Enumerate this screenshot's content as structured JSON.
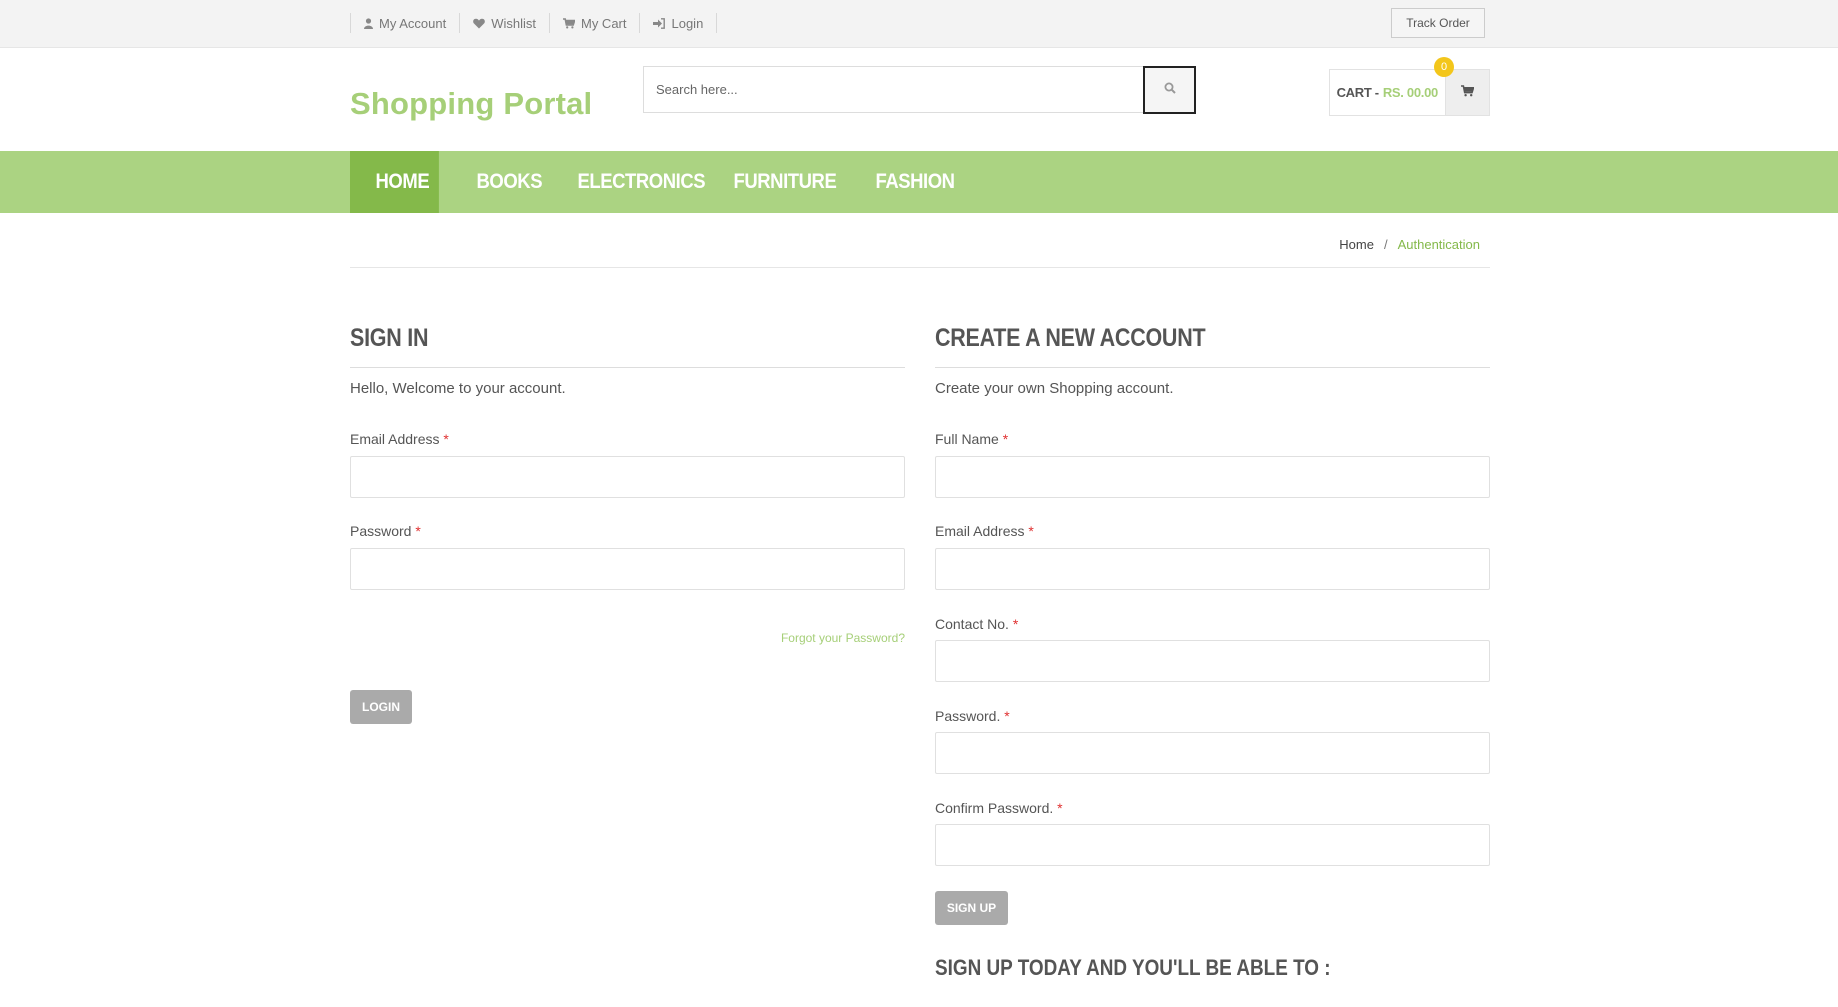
{
  "topbar": {
    "links": [
      {
        "label": "My Account",
        "icon": "user-icon"
      },
      {
        "label": "Wishlist",
        "icon": "heart-icon"
      },
      {
        "label": "My Cart",
        "icon": "cart-icon"
      },
      {
        "label": "Login",
        "icon": "sign-in-icon"
      }
    ],
    "track_order": "Track Order"
  },
  "header": {
    "logo": "Shopping Portal",
    "search_placeholder": "Search here...",
    "cart_label": "CART -",
    "cart_amount": "RS. 00.00",
    "cart_count": "0"
  },
  "nav": {
    "items": [
      "HOME",
      "BOOKS",
      "ELECTRONICS",
      "FURNITURE",
      "FASHION"
    ],
    "active": "HOME"
  },
  "breadcrumb": {
    "home": "Home",
    "separator": "/",
    "current": "Authentication"
  },
  "signin": {
    "title": "SIGN IN",
    "subtitle": "Hello, Welcome to your account.",
    "email_label": "Email Address",
    "password_label": "Password",
    "required_mark": "*",
    "forgot": "Forgot your Password?",
    "login_button": "LOGIN"
  },
  "signup": {
    "title": "CREATE A NEW ACCOUNT",
    "subtitle": "Create your own Shopping account.",
    "fullname_label": "Full Name",
    "email_label": "Email Address",
    "contact_label": "Contact No.",
    "password_label": "Password.",
    "confirm_label": "Confirm Password.",
    "required_mark": "*",
    "signup_button": "SIGN UP",
    "benefits_title": "SIGN UP TODAY AND YOU'LL BE ABLE TO :"
  },
  "colors": {
    "accent_green": "#a6cf78",
    "nav_bg": "#abd382",
    "nav_active": "#84b94a",
    "badge_yellow": "#f3c61b",
    "required_red": "#e03131"
  }
}
